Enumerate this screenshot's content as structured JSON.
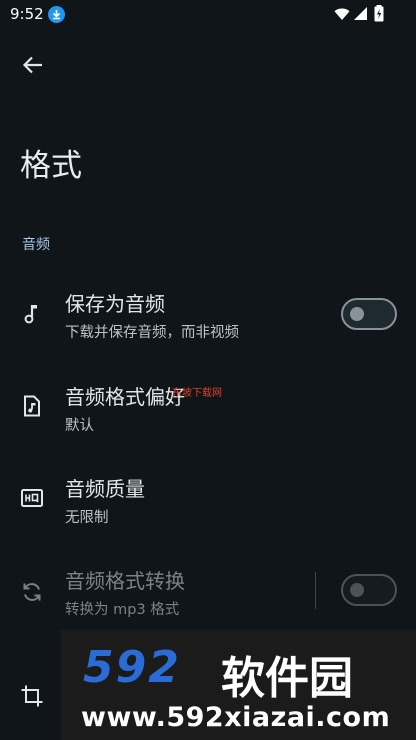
{
  "status_bar": {
    "time": "9:52"
  },
  "header": {
    "title": "格式"
  },
  "section": {
    "audio_label": "音频"
  },
  "rows": [
    {
      "title": "保存为音频",
      "subtitle": "下载并保存音频，而非视频",
      "icon": "music-note-icon"
    },
    {
      "title": "音频格式偏好",
      "subtitle": "默认",
      "icon": "audio-file-icon"
    },
    {
      "title": "音频质量",
      "subtitle": "无限制",
      "icon": "hq-icon"
    },
    {
      "title": "音频格式转换",
      "subtitle": "转换为 mp3 格式",
      "icon": "sync-icon"
    },
    {
      "title": "",
      "subtitle": "",
      "icon": "crop-icon"
    }
  ],
  "toggles": {
    "save_as_audio": false,
    "audio_convert": false
  },
  "overlay_text": "东坡下载网",
  "watermark": {
    "brand_number": "592",
    "brand_text": "软件园",
    "url": "www.592xiazai.com"
  },
  "colors": {
    "background": "#0f1519",
    "accent": "#a7c7e4",
    "download_badge": "#2196f3"
  }
}
